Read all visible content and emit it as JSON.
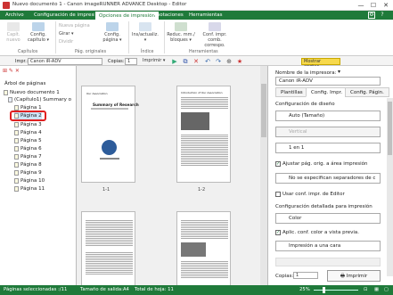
{
  "window": {
    "title": "Nuevo documento 1 - Canon imageRUNNER ADVANCE Desktop - Editor",
    "min": "—",
    "max": "☐",
    "close": "✕"
  },
  "menu": {
    "tabs": [
      "Archivo",
      "Configuración de impresión",
      "Opciones de impresión",
      "Anotaciones",
      "Herramientas"
    ],
    "active": 2
  },
  "ribbon": {
    "btn_capitulo_nuevo": "Capít. nuevo",
    "btn_config_capitulo": "Config. capítulo ▾",
    "btn_nueva_pagina": "Nueva página",
    "btn_girar": "Girar ▾",
    "btn_dividir": "Dividir",
    "btn_config_pagina": "Config. página ▾",
    "btn_ins_actualiz": "Ins/actualiz. ▾",
    "btn_reduc_mm": "Reduc. mm./ bloques ▾",
    "btn_conf_impr_comb": "Conf. impr. comb. correspo.",
    "grp_capitulos": "Capítulos",
    "grp_pag_originales": "Pág. originales",
    "grp_indice": "Índice",
    "grp_herramientas": "Herramientas"
  },
  "toolbar": {
    "impr_label": "Impr.:",
    "printer": "Canon iR-ADV",
    "copias_label": "Copias:",
    "copias": "1",
    "impr_btn": "Imprimir ▾",
    "show_annot": "Mostrar anotac."
  },
  "tree": {
    "title": "Árbol de páginas",
    "root": "Nuevo documento 1",
    "chapter": "(Capítulo1) Summary o",
    "pages": [
      "Página 1",
      "Página 2",
      "Página 3",
      "Página 4",
      "Página 5",
      "Página 6",
      "Página 7",
      "Página 8",
      "Página 9",
      "Página 10",
      "Página 11"
    ]
  },
  "canvas": {
    "labels": [
      "1-1",
      "1-2"
    ],
    "p1": {
      "heading": "Summary of Research",
      "sub": "Our Association"
    },
    "p2": {
      "heading": "Introduction of Our Association"
    }
  },
  "panel": {
    "printer_label": "Nombre de la impresora:",
    "printer": "Canon iR-ADV",
    "tabs": [
      "Plantillas",
      "Config. Impr.",
      "Config. Págin."
    ],
    "active_tab": 1,
    "sec1": "Configuración de diseño",
    "layout_auto": "Auto (Tamaño)",
    "orientation": "Vertical",
    "one_in_one": "1 en 1",
    "chk_adjust": "Ajustar pág. orig. a área impresión",
    "chk_adjust_checked": true,
    "no_sep": "No se especifican separadores de c",
    "chk_use_conf": "Usar conf. impr. de Editor",
    "chk_use_conf_checked": false,
    "sec2": "Configuración detallada para impresión",
    "color": "Color",
    "chk_apply": "Aplic. conf. color a vista previa.",
    "chk_apply_checked": true,
    "one_side": "Impresión a una cara",
    "copies_label": "Copias:",
    "copies": "1",
    "print_btn": "Imprimir"
  },
  "status": {
    "pages_selected": "Páginas seleccionadas :/11",
    "paper": "Tamaño de salida:A4",
    "total": "Total de hoja: 11",
    "zoom": "25%"
  },
  "colors": {
    "brand": "#1f7a3a",
    "highlight": "#e02020"
  }
}
